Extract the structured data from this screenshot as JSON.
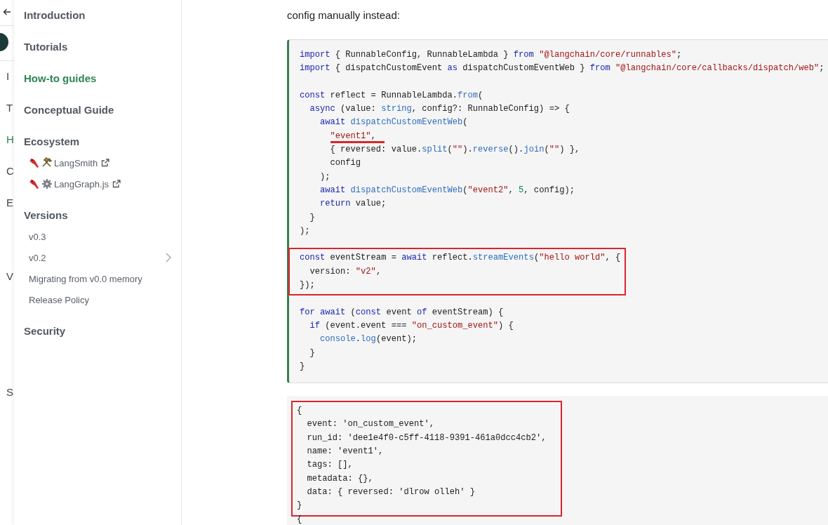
{
  "back_sidebar": {
    "items": [
      {
        "label": "I",
        "selected": false
      },
      {
        "label": "T",
        "selected": false
      },
      {
        "label": "H",
        "selected": true
      },
      {
        "label": "C",
        "selected": false
      },
      {
        "label": "E",
        "selected": false
      },
      {
        "label": "V",
        "selected": false
      },
      {
        "label": "S",
        "selected": false
      }
    ]
  },
  "sidebar": {
    "items": [
      {
        "label": "Introduction",
        "selected": false
      },
      {
        "label": "Tutorials",
        "selected": false
      },
      {
        "label": "How-to guides",
        "selected": true
      },
      {
        "label": "Conceptual Guide",
        "selected": false
      },
      {
        "label": "Ecosystem",
        "selected": false,
        "children": [
          {
            "label": "LangSmith",
            "selected": false,
            "external": true
          },
          {
            "label": "LangGraph.js",
            "selected": false,
            "external": true
          }
        ]
      },
      {
        "label": "Versions",
        "selected": false,
        "children": [
          {
            "label": "v0.3",
            "selected": false
          },
          {
            "label": "v0.2",
            "selected": false,
            "expandable": true
          },
          {
            "label": "Migrating from v0.0 memory",
            "selected": false
          },
          {
            "label": "Release Policy",
            "selected": false
          }
        ]
      },
      {
        "label": "Security",
        "selected": false
      }
    ]
  },
  "content": {
    "intro": "config manually instead:",
    "code_block": {
      "lines": [
        {
          "kind": "code",
          "tokens": [
            {
              "kind": "keyword",
              "text": "import"
            },
            {
              "kind": "plain",
              "text": " { RunnableConfig, RunnableLambda } "
            },
            {
              "kind": "keyword",
              "text": "from "
            },
            {
              "kind": "string",
              "text": "\"@langchain/core/runnables\""
            },
            {
              "kind": "plain",
              "text": ";"
            }
          ]
        },
        {
          "kind": "code",
          "tokens": [
            {
              "kind": "keyword",
              "text": "import"
            },
            {
              "kind": "plain",
              "text": " { dispatchCustomEvent "
            },
            {
              "kind": "keyword",
              "text": "as"
            },
            {
              "kind": "plain",
              "text": " dispatchCustomEventWeb } "
            },
            {
              "kind": "keyword",
              "text": "from "
            },
            {
              "kind": "string",
              "text": "\"@langchain/core/callbacks/dispatch/web\""
            },
            {
              "kind": "plain",
              "text": ";"
            }
          ]
        },
        {
          "kind": "blank"
        },
        {
          "kind": "code",
          "tokens": [
            {
              "kind": "keyword",
              "text": "const"
            },
            {
              "kind": "plain",
              "text": " reflect = RunnableLambda."
            },
            {
              "kind": "function",
              "text": "from"
            },
            {
              "kind": "plain",
              "text": "("
            }
          ]
        },
        {
          "kind": "code",
          "tokens": [
            {
              "kind": "keyword",
              "text": "  async"
            },
            {
              "kind": "plain",
              "text": " (value: "
            },
            {
              "kind": "function",
              "text": "string"
            },
            {
              "kind": "plain",
              "text": ", config?: RunnableConfig) => {"
            }
          ]
        },
        {
          "kind": "code",
          "tokens": [
            {
              "kind": "keyword",
              "text": "    await"
            },
            {
              "kind": "function",
              "text": " dispatchCustomEventWeb"
            },
            {
              "kind": "plain",
              "text": "("
            }
          ]
        },
        {
          "kind": "code",
          "underlined": true,
          "tokens": [
            {
              "kind": "string",
              "text": "      \"event1\""
            },
            {
              "kind": "plain",
              "text": ","
            }
          ]
        },
        {
          "kind": "code",
          "tokens": [
            {
              "kind": "plain",
              "text": "      { reversed: value."
            },
            {
              "kind": "function",
              "text": "split"
            },
            {
              "kind": "plain",
              "text": "("
            },
            {
              "kind": "string",
              "text": "\"\""
            },
            {
              "kind": "plain",
              "text": ")."
            },
            {
              "kind": "function",
              "text": "reverse"
            },
            {
              "kind": "plain",
              "text": "()."
            },
            {
              "kind": "function",
              "text": "join"
            },
            {
              "kind": "plain",
              "text": "("
            },
            {
              "kind": "string",
              "text": "\"\""
            },
            {
              "kind": "plain",
              "text": ") },"
            }
          ]
        },
        {
          "kind": "code",
          "tokens": [
            {
              "kind": "plain",
              "text": "      config"
            }
          ]
        },
        {
          "kind": "code",
          "tokens": [
            {
              "kind": "plain",
              "text": "    );"
            }
          ]
        },
        {
          "kind": "code",
          "tokens": [
            {
              "kind": "keyword",
              "text": "    await"
            },
            {
              "kind": "function",
              "text": " dispatchCustomEventWeb"
            },
            {
              "kind": "plain",
              "text": "("
            },
            {
              "kind": "string",
              "text": "\"event2\""
            },
            {
              "kind": "plain",
              "text": ", "
            },
            {
              "kind": "number",
              "text": "5"
            },
            {
              "kind": "plain",
              "text": ", config);"
            }
          ]
        },
        {
          "kind": "code",
          "tokens": [
            {
              "kind": "keyword",
              "text": "    return"
            },
            {
              "kind": "plain",
              "text": " value;"
            }
          ]
        },
        {
          "kind": "code",
          "tokens": [
            {
              "kind": "plain",
              "text": "  }"
            }
          ]
        },
        {
          "kind": "code",
          "tokens": [
            {
              "kind": "plain",
              "text": ");"
            }
          ]
        },
        {
          "kind": "blank"
        },
        {
          "kind": "box",
          "lines": [
            {
              "kind": "code",
              "tokens": [
                {
                  "kind": "keyword",
                  "text": "const"
                },
                {
                  "kind": "plain",
                  "text": " eventStream = "
                },
                {
                  "kind": "keyword",
                  "text": "await"
                },
                {
                  "kind": "plain",
                  "text": " reflect."
                },
                {
                  "kind": "function",
                  "text": "streamEvents"
                },
                {
                  "kind": "plain",
                  "text": "("
                },
                {
                  "kind": "string",
                  "text": "\"hello world\""
                },
                {
                  "kind": "plain",
                  "text": ", {"
                }
              ]
            },
            {
              "kind": "code",
              "tokens": [
                {
                  "kind": "plain",
                  "text": "  version: "
                },
                {
                  "kind": "string",
                  "text": "\"v2\""
                },
                {
                  "kind": "plain",
                  "text": ","
                }
              ]
            },
            {
              "kind": "code",
              "tokens": [
                {
                  "kind": "plain",
                  "text": "});"
                }
              ]
            }
          ]
        },
        {
          "kind": "blank"
        },
        {
          "kind": "code",
          "tokens": [
            {
              "kind": "keyword",
              "text": "for await"
            },
            {
              "kind": "plain",
              "text": " ("
            },
            {
              "kind": "keyword",
              "text": "const"
            },
            {
              "kind": "plain",
              "text": " event "
            },
            {
              "kind": "keyword",
              "text": "of"
            },
            {
              "kind": "plain",
              "text": " eventStream) {"
            }
          ]
        },
        {
          "kind": "code",
          "tokens": [
            {
              "kind": "keyword",
              "text": "  if"
            },
            {
              "kind": "plain",
              "text": " (event.event === "
            },
            {
              "kind": "string",
              "text": "\"on_custom_event\""
            },
            {
              "kind": "plain",
              "text": ") {"
            }
          ]
        },
        {
          "kind": "code",
          "tokens": [
            {
              "kind": "function",
              "text": "    console"
            },
            {
              "kind": "plain",
              "text": "."
            },
            {
              "kind": "function",
              "text": "log"
            },
            {
              "kind": "plain",
              "text": "(event);"
            }
          ]
        },
        {
          "kind": "code",
          "tokens": [
            {
              "kind": "plain",
              "text": "  }"
            }
          ]
        },
        {
          "kind": "code",
          "tokens": [
            {
              "kind": "plain",
              "text": "}"
            }
          ]
        }
      ]
    },
    "output_block": {
      "lines": [
        {
          "kind": "box",
          "lines": [
            {
              "kind": "text",
              "text": "{"
            },
            {
              "kind": "text",
              "text": "  event: 'on_custom_event',"
            },
            {
              "kind": "text",
              "text": "  run_id: 'dee1e4f0-c5ff-4118-9391-461a0dcc4cb2',"
            },
            {
              "kind": "text",
              "text": "  name: 'event1',"
            },
            {
              "kind": "text",
              "text": "  tags: [],"
            },
            {
              "kind": "text",
              "text": "  metadata: {},"
            },
            {
              "kind": "text",
              "text": "  data: { reversed: 'dlrow olleh' }"
            },
            {
              "kind": "text",
              "text": "}"
            }
          ]
        },
        {
          "kind": "text",
          "text": "{"
        }
      ]
    }
  }
}
